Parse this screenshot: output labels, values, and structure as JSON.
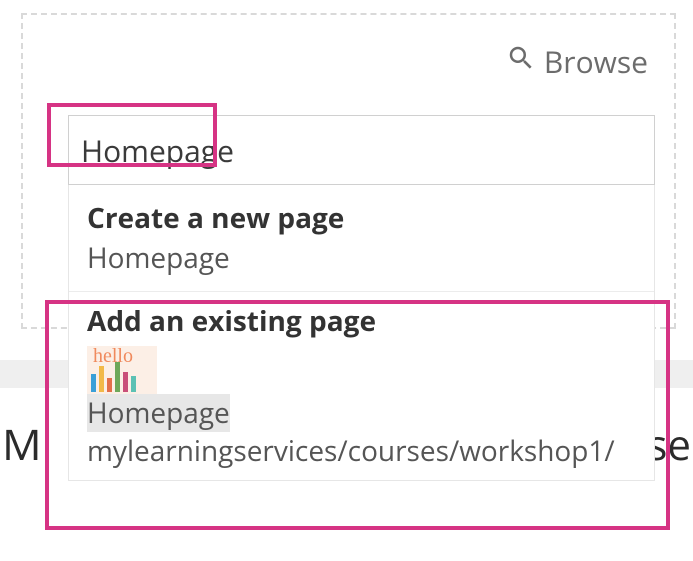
{
  "browse": {
    "label": "Browse"
  },
  "search": {
    "value": "Homepage"
  },
  "dropdown": {
    "create": {
      "header": "Create a new page",
      "name": "Homepage"
    },
    "existing": {
      "header": "Add an existing page",
      "item": {
        "title_match": "Homepage",
        "path": "mylearningservices/courses/workshop1/"
      }
    }
  },
  "background": {
    "left_char": "M",
    "right_chars": "rse"
  }
}
